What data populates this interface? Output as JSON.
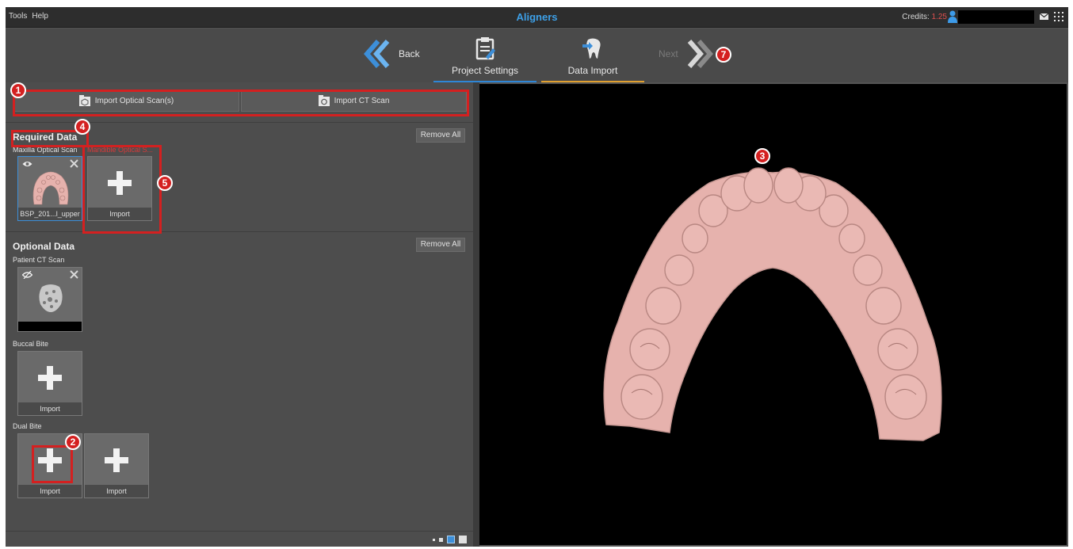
{
  "menu": {
    "tools": "Tools",
    "help": "Help"
  },
  "app_title": "Aligners",
  "credits": {
    "label": "Credits:",
    "value": "1.25"
  },
  "wizard": {
    "back_label": "Back",
    "steps": [
      {
        "label": "Project Settings"
      },
      {
        "label": "Data Import"
      }
    ],
    "next_label": "Next"
  },
  "import": {
    "optical_label": "Import Optical Scan(s)",
    "ct_label": "Import CT Scan"
  },
  "required": {
    "title": "Required Data",
    "remove_all": "Remove All",
    "maxilla_label": "Maxilla Optical Scan",
    "maxilla_file": "BSP_201...l_upper",
    "mandible_label": "Mandible Optical S...",
    "mandible_button": "Import"
  },
  "optional": {
    "title": "Optional Data",
    "remove_all": "Remove All",
    "ct_label": "Patient CT Scan",
    "buccal_label": "Buccal Bite",
    "buccal_button": "Import",
    "dual_label": "Dual Bite",
    "dual_button_1": "Import",
    "dual_button_2": "Import"
  },
  "callouts": {
    "c1": "1",
    "c2": "2",
    "c3": "3",
    "c4": "4",
    "c5": "5",
    "c7": "7"
  },
  "colors": {
    "accent_blue": "#3da0e8",
    "warning_red": "#d83a3a",
    "callout_red": "#d42020",
    "model_pink": "#e6b2ad",
    "step_active": "#e0a030"
  }
}
